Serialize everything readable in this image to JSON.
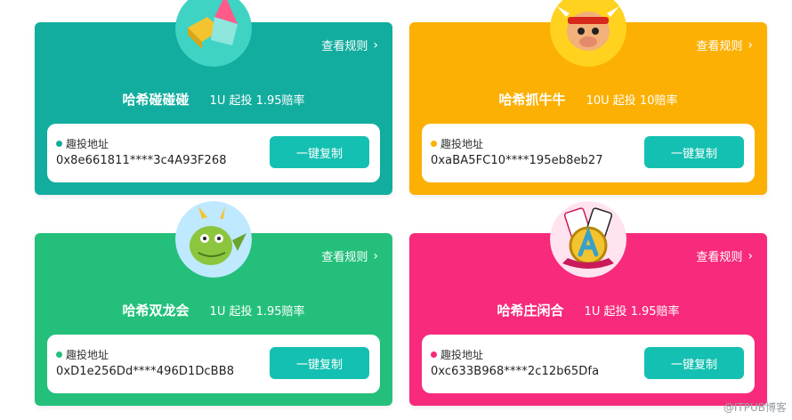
{
  "cards": [
    {
      "name": "哈希碰碰碰",
      "meta": "1U 起投 1.95赔率",
      "rules": "查看规则",
      "chevron": "›",
      "addr_label": "趣投地址",
      "address": "0x8e661811****3c4A93F268",
      "copy_label": "一键复制",
      "color": "#13ad9f",
      "icon": "blocks-icon"
    },
    {
      "name": "哈希抓牛牛",
      "meta": "10U 起投 10赔率",
      "rules": "查看规则",
      "chevron": "›",
      "addr_label": "趣投地址",
      "address": "0xaBA5FC10****195eb8eb27",
      "copy_label": "一键复制",
      "color": "#fbb003",
      "icon": "bull-icon"
    },
    {
      "name": "哈希双龙会",
      "meta": "1U 起投 1.95赔率",
      "rules": "查看规则",
      "chevron": "›",
      "addr_label": "趣投地址",
      "address": "0xD1e256Dd****496D1DcBB8",
      "copy_label": "一键复制",
      "color": "#24c07b",
      "icon": "dragon-icon"
    },
    {
      "name": "哈希庄闲合",
      "meta": "1U 起投 1.95赔率",
      "rules": "查看规则",
      "chevron": "›",
      "addr_label": "趣投地址",
      "address": "0xc633B968****2c12b65Dfa",
      "copy_label": "一键复制",
      "color": "#f72a7b",
      "icon": "card-a-icon"
    }
  ],
  "watermark": "@ITPUB博客"
}
